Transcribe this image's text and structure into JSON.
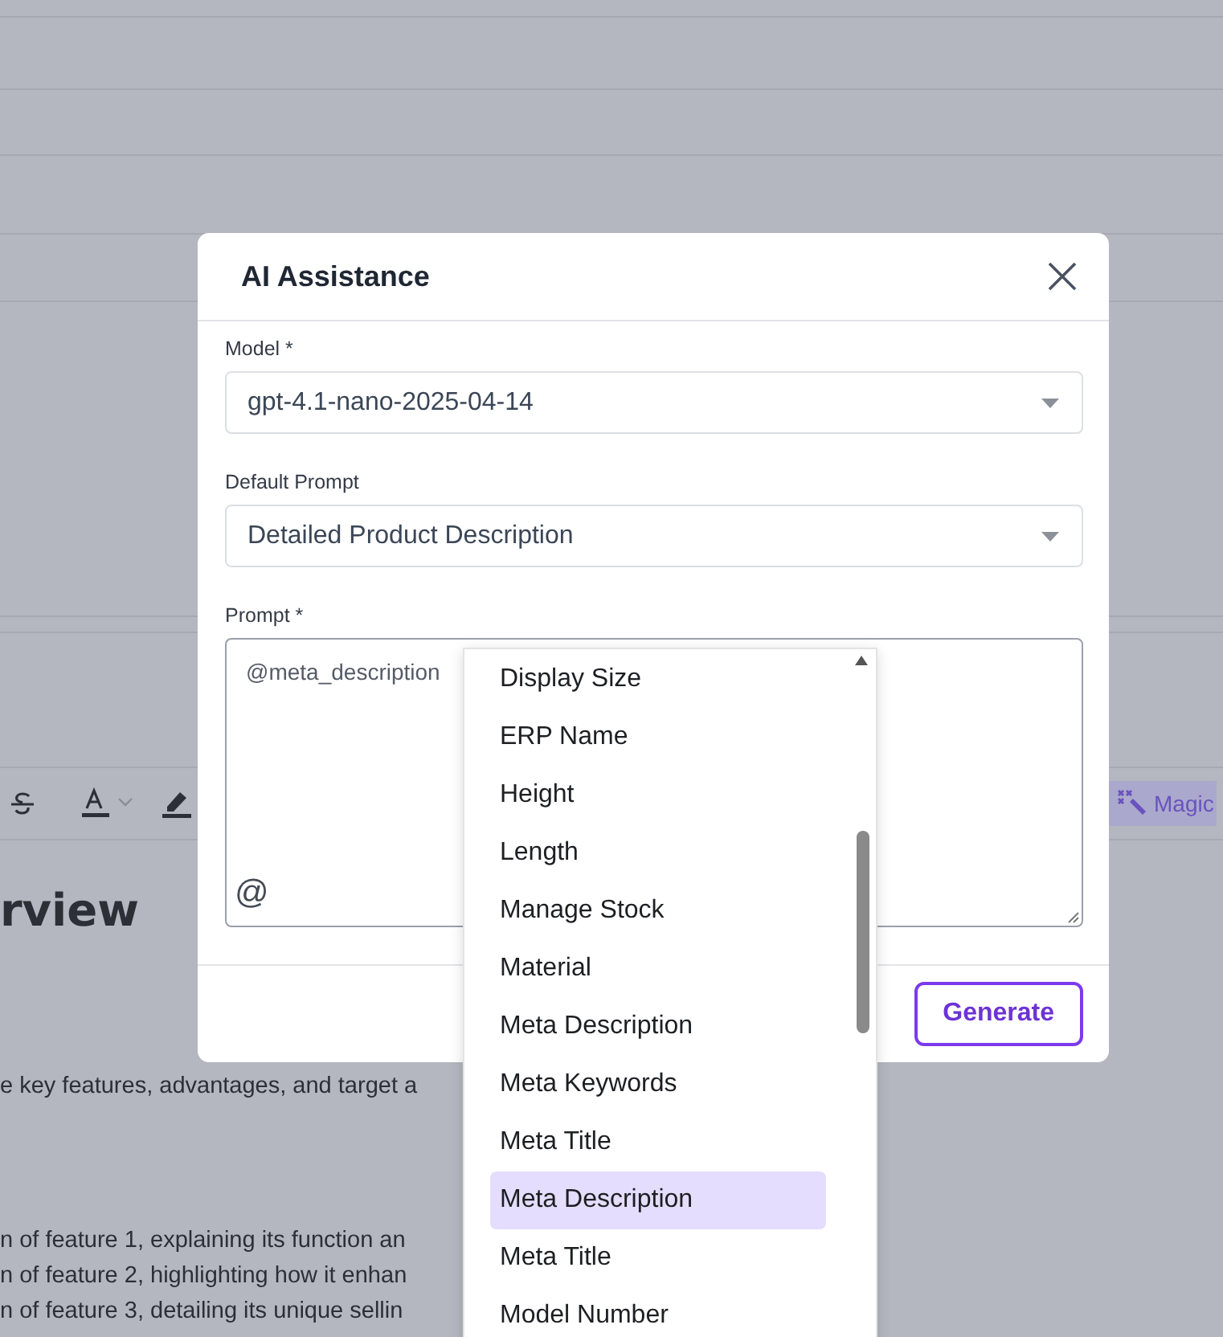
{
  "background_page": {
    "toolbar": {
      "magic_button": "Magic"
    },
    "heading": "rview",
    "paragraphs": [
      "e key features, advantages, and target a",
      "n of feature 1, explaining its function an",
      "n of feature 2, highlighting how it enhan",
      "n of feature 3, detailing its unique sellin"
    ]
  },
  "dialog": {
    "title": "AI Assistance",
    "fields": [
      {
        "kind": "select",
        "label": "Model *",
        "value": "gpt-4.1-nano-2025-04-14"
      },
      {
        "kind": "select",
        "label": "Default Prompt",
        "value": "Detailed Product Description"
      },
      {
        "kind": "textarea",
        "label": "Prompt *",
        "value": "@meta_description",
        "mention_button": "@"
      }
    ],
    "generate_button": "Generate"
  },
  "mention_menu": {
    "items": [
      {
        "label": "Display Size",
        "selected": false
      },
      {
        "label": "ERP Name",
        "selected": false
      },
      {
        "label": "Height",
        "selected": false
      },
      {
        "label": "Length",
        "selected": false
      },
      {
        "label": "Manage Stock",
        "selected": false
      },
      {
        "label": "Material",
        "selected": false
      },
      {
        "label": "Meta Description",
        "selected": false
      },
      {
        "label": "Meta Keywords",
        "selected": false
      },
      {
        "label": "Meta Title",
        "selected": false
      },
      {
        "label": "Meta Description",
        "selected": true
      },
      {
        "label": "Meta Title",
        "selected": false
      },
      {
        "label": "Model Number",
        "selected": false
      }
    ]
  }
}
